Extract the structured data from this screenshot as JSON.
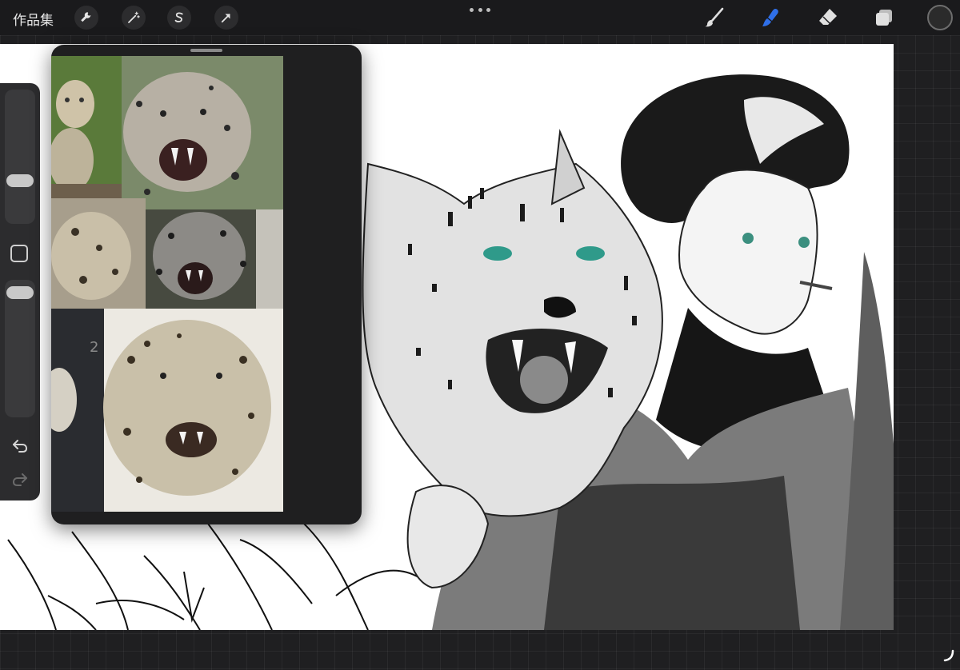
{
  "toolbar": {
    "gallery_label": "作品集",
    "left_tools": [
      "wrench-icon",
      "magic-wand-icon",
      "selection-icon",
      "transform-arrow-icon"
    ],
    "right_tools": [
      "brush-icon",
      "smudge-icon",
      "eraser-icon",
      "layers-icon"
    ],
    "active_tool": "smudge-icon",
    "accent_color": "#2f6fe8",
    "current_color": "#2b2b2b"
  },
  "sidebar": {
    "brush_size_level": 0.25,
    "opacity_level": 0.05,
    "buttons": [
      "modify-square-icon",
      "undo-icon",
      "redo-icon"
    ]
  },
  "reference": {
    "panel": "reference-window",
    "images": [
      "snow-leopard-cub-photo",
      "snow-leopard-snarl-photo",
      "snow-leopard-face-photo",
      "snow-leopard-side-photo",
      "snow-leopard-closeup-photo"
    ]
  },
  "canvas": {
    "background": "#ffffff",
    "subject": "snow-leopard-and-man-illustration"
  }
}
